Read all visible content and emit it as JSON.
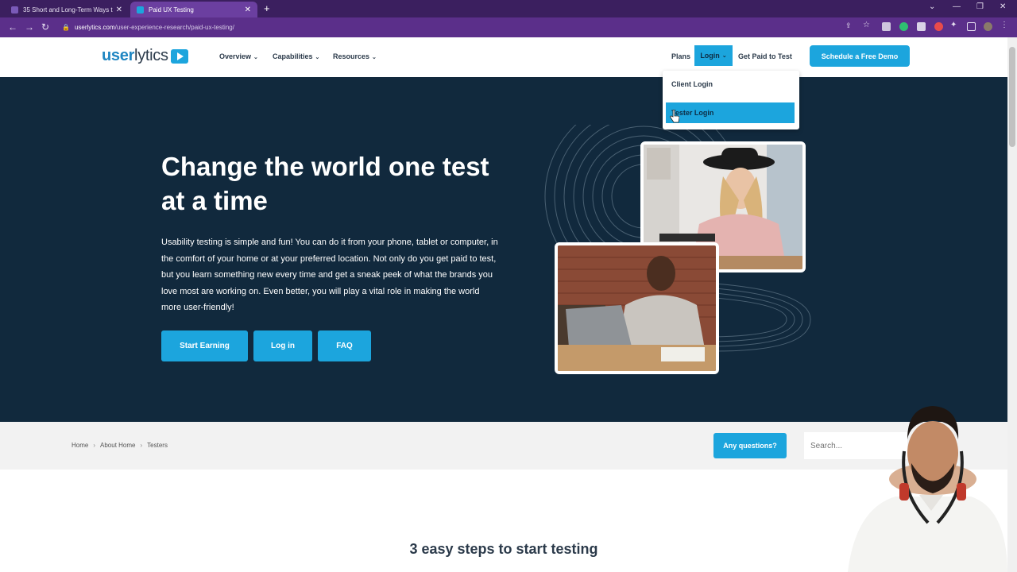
{
  "browser": {
    "tabs": [
      {
        "title": "35 Short and Long-Term Ways to",
        "active": false
      },
      {
        "title": "Paid UX Testing",
        "active": true
      }
    ],
    "url_host": "userlytics.com",
    "url_path": "/user-experience-research/paid-ux-testing/"
  },
  "header": {
    "logo_bold": "user",
    "logo_light": "lytics",
    "menu": [
      "Overview",
      "Capabilities",
      "Resources"
    ],
    "plans": "Plans",
    "login": "Login",
    "get_paid": "Get Paid to Test",
    "demo": "Schedule a Free Demo"
  },
  "login_dropdown": {
    "items": [
      "Client Login",
      "Tester Login"
    ],
    "highlighted": "Tester Login"
  },
  "hero": {
    "title": "Change the world one test at a time",
    "body": "Usability testing is simple and fun! You can do it from your phone, tablet or computer, in the comfort of your home or at your preferred location. Not only do you get paid to test, but you learn something new every time and get a sneak peek of what the brands you love most are working on. Even better, you will play a vital role in making the world more user-friendly!",
    "buttons": [
      "Start Earning",
      "Log in",
      "FAQ"
    ]
  },
  "breadcrumb": [
    "Home",
    "About Home",
    "Testers"
  ],
  "help": {
    "questions": "Any questions?",
    "search_placeholder": "Search..."
  },
  "section_title": "3 easy steps to start testing",
  "colors": {
    "accent": "#1ca5dd",
    "hero_bg": "#11293d",
    "chrome": "#3b1f5f"
  }
}
